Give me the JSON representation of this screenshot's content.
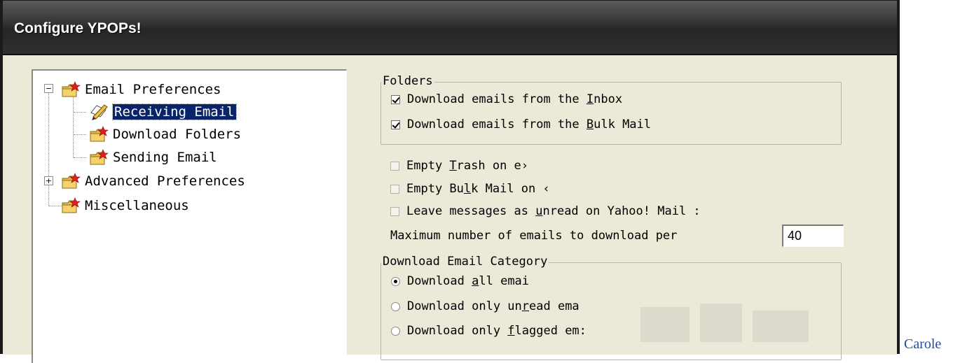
{
  "window": {
    "title": "Configure YPOPs!"
  },
  "tree": {
    "items": [
      {
        "label": "Email Preferences",
        "expander": "−",
        "level": 0,
        "selected": false,
        "icon": "folder-star-icon"
      },
      {
        "label": "Receiving Email",
        "level": 1,
        "selected": true,
        "icon": "pencil-edit-icon"
      },
      {
        "label": "Download Folders",
        "level": 1,
        "selected": false,
        "icon": "folder-star-icon"
      },
      {
        "label": "Sending Email",
        "level": 1,
        "selected": false,
        "icon": "folder-star-icon"
      },
      {
        "label": "Advanced Preferences",
        "expander": "+",
        "level": 0,
        "selected": false,
        "icon": "folder-star-icon"
      },
      {
        "label": "Miscellaneous",
        "level": 0,
        "selected": false,
        "icon": "folder-star-icon"
      }
    ]
  },
  "folders_group": {
    "legend": "Folders",
    "inbox": {
      "before": "Download emails from the ",
      "mnemonic": "I",
      "after": "nbox",
      "checked": true
    },
    "bulk": {
      "before": "Download emails from the ",
      "mnemonic": "B",
      "after": "ulk Mail",
      "checked": true
    }
  },
  "options": {
    "empty_trash": {
      "before": "Empty ",
      "mnemonic": "T",
      "after": "rash on e›",
      "checked": false,
      "enabled": false
    },
    "empty_bulk": {
      "before": "Empty Bu",
      "mnemonic": "l",
      "after": "k Mail on ‹",
      "checked": false,
      "enabled": false
    },
    "leave_unread": {
      "before": "Leave messages as ",
      "mnemonic": "u",
      "after": "nread on Yahoo! Mail :",
      "checked": false,
      "enabled": false
    }
  },
  "max_emails": {
    "label": "Maximum number of emails to download per",
    "value": "40"
  },
  "category_group": {
    "legend": "Download Email Category",
    "all": {
      "before": "Download ",
      "mnemonic": "a",
      "after": "ll emai",
      "checked": true
    },
    "unread": {
      "before": "Download only un",
      "mnemonic": "r",
      "after": "ead ema",
      "checked": false
    },
    "flagged": {
      "before": "Download only ",
      "mnemonic": "f",
      "after": "lagged em:",
      "checked": false
    }
  },
  "caption": "Carole",
  "colors": {
    "selection": "#0a246a",
    "dialog_bg": "#ece9d8",
    "caption": "#1f4e9e"
  }
}
